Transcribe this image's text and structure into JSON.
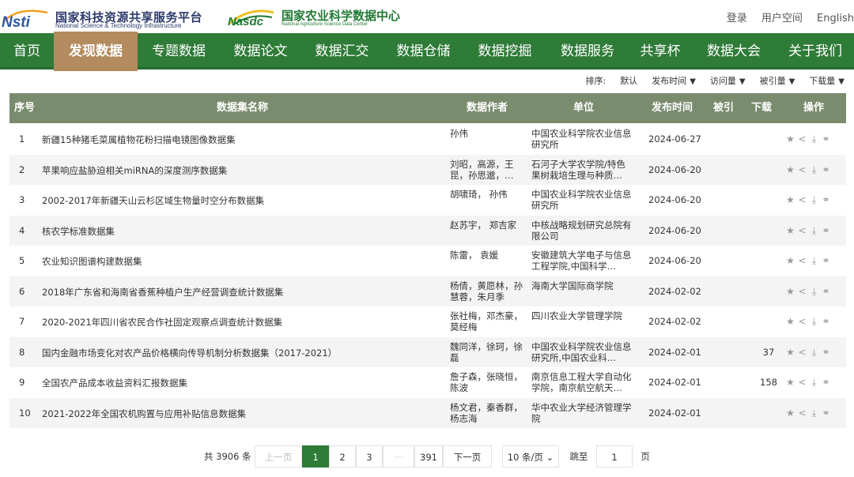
{
  "header": {
    "logo1_mark": "Nsti",
    "logo1_cn": "国家科技资源共享服务平台",
    "logo1_en": "National Science & Technology Infrastructure",
    "logo2_mark": "Nasdc",
    "logo2_cn": "国家农业科学数据中心",
    "logo2_en": "National Agriculture Science Data Center",
    "login": "登录",
    "user_space": "用户空间",
    "english": "English"
  },
  "nav": [
    "首页",
    "发现数据",
    "专题数据",
    "数据论文",
    "数据汇交",
    "数据仓储",
    "数据挖掘",
    "数据服务",
    "共享杯",
    "数据大会",
    "关于我们"
  ],
  "nav_active_index": 1,
  "sort": {
    "label": "排序:",
    "options": [
      "默认",
      "发布时间",
      "访问量",
      "被引量",
      "下载量"
    ],
    "arrow": "▼"
  },
  "table": {
    "headers": {
      "idx": "序号",
      "name": "数据集名称",
      "author": "数据作者",
      "unit": "单位",
      "date": "发布时间",
      "cite": "被引",
      "down": "下载",
      "ops": "操作"
    },
    "rows": [
      {
        "idx": "1",
        "name": "新疆15种猪毛菜属植物花粉扫描电镜图像数据集",
        "author": "孙伟",
        "unit": "中国农业科学院农业信息研究所",
        "date": "2024-06-27",
        "down": ""
      },
      {
        "idx": "2",
        "name": "苹果响应盐胁迫相关miRNA的深度测序数据集",
        "author": "刘昭，高源，王昆，孙思邈，…",
        "unit": "石河子大学农学院/特色果树栽培生理与种质…",
        "date": "2024-06-20",
        "down": ""
      },
      {
        "idx": "3",
        "name": "2002-2017年新疆天山云杉区域生物量时空分布数据集",
        "author": "胡啸琦， 孙伟",
        "unit": "中国农业科学院农业信息研究所",
        "date": "2024-06-20",
        "down": ""
      },
      {
        "idx": "4",
        "name": "核农学标准数据集",
        "author": "赵苏宇， 郑吉家",
        "unit": "中核战略规划研究总院有限公司",
        "date": "2024-06-20",
        "down": ""
      },
      {
        "idx": "5",
        "name": "农业知识图谱构建数据集",
        "author": "陈雷， 袁媛",
        "unit": "安徽建筑大学电子与信息工程学院,中国科学…",
        "date": "2024-06-20",
        "down": ""
      },
      {
        "idx": "6",
        "name": "2018年广东省和海南省香蕉种植户生产经营调查统计数据集",
        "author": "杨倩，黄愿林，孙慧蓉，朱月季",
        "unit": "海南大学国际商学院",
        "date": "2024-02-02",
        "down": ""
      },
      {
        "idx": "7",
        "name": "2020-2021年四川省农民合作社固定观察点调查统计数据集",
        "author": "张社梅，邓杰豪，莫经梅",
        "unit": "四川农业大学管理学院",
        "date": "2024-02-02",
        "down": ""
      },
      {
        "idx": "8",
        "name": "国内金融市场变化对农产品价格横向传导机制分析数据集（2017-2021）",
        "author": "魏同洋，徐珂，徐磊",
        "unit": "中国农业科学院农业信息研究所,中国农业科…",
        "date": "2024-02-01",
        "down": "37"
      },
      {
        "idx": "9",
        "name": "全国农产品成本收益资料汇报数据集",
        "author": "詹子森，张晓恒，陈波",
        "unit": "南京信息工程大学自动化学院，南京航空航天…",
        "date": "2024-02-01",
        "down": "158"
      },
      {
        "idx": "10",
        "name": "2021-2022年全国农机购置与应用补贴信息数据集",
        "author": "杨文君，秦香群，杨志海",
        "unit": "华中农业大学经济管理学院",
        "date": "2024-02-01",
        "down": ""
      }
    ]
  },
  "icons": [
    "star-icon",
    "share-icon",
    "download-icon",
    "link-icon"
  ],
  "icon_glyphs": {
    "star": "★",
    "share": "<",
    "download": "⤓",
    "link": "⚭"
  },
  "pager": {
    "total": "共 3906 条",
    "prev": "上一页",
    "pages": [
      "1",
      "2",
      "3",
      "···",
      "391"
    ],
    "next": "下一页",
    "size": "10 条/页",
    "size_caret": "⌄",
    "goto_label": "跳至",
    "goto_value": "1",
    "page_unit": "页"
  },
  "colors": {
    "nav_bg": "#2f7b38",
    "nav_active": "#b38b5e",
    "table_head": "#7a8c6e"
  }
}
